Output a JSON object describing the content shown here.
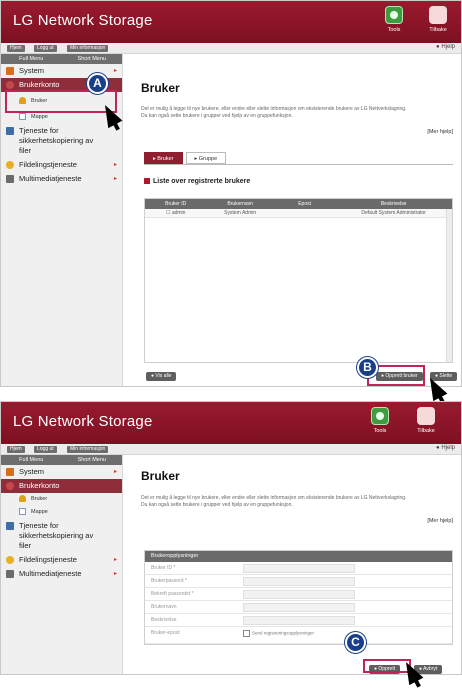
{
  "app": {
    "brand": "LG Network Storage",
    "tools_label": "Tools",
    "exit_label": "Tilbake",
    "toolbar": [
      "Hjem",
      "Logg ut",
      "Min informasjon"
    ],
    "help_label": "Hjelp"
  },
  "sidebar": {
    "tabs": [
      "Full Menu",
      "Short Menu"
    ],
    "system": "System",
    "user_account": "Brukerkonto",
    "user": "Bruker",
    "group": "Mappe",
    "backup": "Tjeneste for sikkerhetskopiering av filer",
    "backup_lines": [
      "Tjeneste for",
      "sikkerhetskopiering av",
      "filer"
    ],
    "share": "Fildelingstjeneste",
    "media": "Multimediatjeneste"
  },
  "panel_a": {
    "title": "Bruker",
    "description": "Det er mulig å legge til nye brukere, eller endre eller slette informasjon om eksisterende brukere av LG Nettverkslagring. Du kan også sette brukere i grupper ved hjelp av en gruppefunksjon.",
    "description_lines": [
      "Det er mulig å legge til nye brukere, eller endre eller slette informasjon om eksisterende brukere av LG Nettverkslagring.",
      "Du kan også sette brukere i grupper ved hjelp av en gruppefunksjon."
    ],
    "more": "[Mer hjelp]",
    "tabs": [
      "Bruker",
      "Gruppe"
    ],
    "list_title": "Liste over registrerte brukere",
    "columns": [
      "Bruker ID",
      "Brukernavn",
      "Epost",
      "Beskrivelse"
    ],
    "rows": [
      [
        "admin",
        "System Admin",
        "",
        "Default System Administrator"
      ]
    ],
    "btn_left": "Vis alle",
    "btn_create": "Opprett bruker",
    "btn_delete": "Slette"
  },
  "panel_b": {
    "title": "Bruker",
    "description_lines": [
      "Det er mulig å legge til nye brukere, eller endre eller slette informasjon om eksisterende brukere av LG Nettverkslagring.",
      "Du kan også sette brukere i grupper ved hjelp av en gruppefunksjon."
    ],
    "more": "[Mer hjelp]",
    "form_title": "Brukeropplysninger",
    "fields": [
      "Bruker ID *",
      "Brukerpassord *",
      "Bekreft passordet *",
      "Brukernavn",
      "Beskrivelse",
      "Bruker-epost"
    ],
    "checkbox_label": "Send registreringsopplysninger",
    "btn_save": "Opprett",
    "btn_cancel": "Avbryt"
  },
  "callouts": [
    "A",
    "B",
    "C"
  ],
  "colors": {
    "header": "#8f1e2e",
    "callout": "#1a3f8a",
    "highlight": "#c0245a"
  }
}
